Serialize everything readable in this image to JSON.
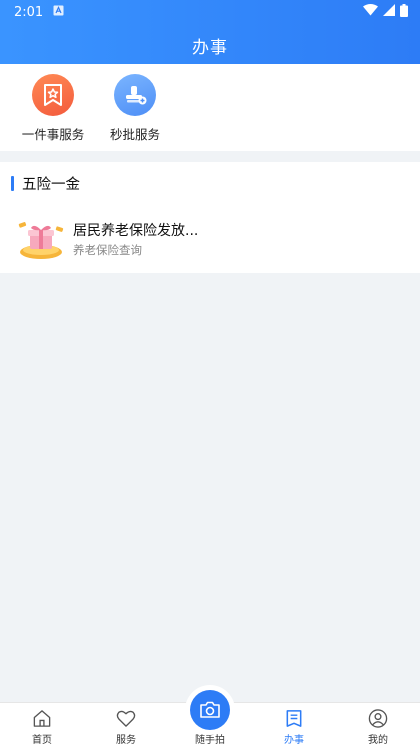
{
  "status_bar": {
    "time": "2:01"
  },
  "header": {
    "title": "办事"
  },
  "shortcuts": [
    {
      "label": "一件事服务",
      "icon": "star-ticket-icon",
      "color": "#f35a3c"
    },
    {
      "label": "秒批服务",
      "icon": "stamp-icon",
      "color": "#4d8ef6"
    }
  ],
  "section": {
    "title": "五险一金",
    "items": [
      {
        "name": "居民养老保险发放...",
        "sub": "养老保险查询",
        "icon": "gift-box-icon"
      }
    ]
  },
  "tabbar": {
    "tabs": [
      {
        "label": "首页",
        "icon": "home-icon"
      },
      {
        "label": "服务",
        "icon": "heart-icon"
      },
      {
        "label": "随手拍",
        "icon": "camera-icon"
      },
      {
        "label": "办事",
        "icon": "document-icon",
        "active": true
      },
      {
        "label": "我的",
        "icon": "user-icon"
      }
    ]
  },
  "colors": {
    "primary": "#2d7cf6",
    "background": "#f0f3f6"
  }
}
